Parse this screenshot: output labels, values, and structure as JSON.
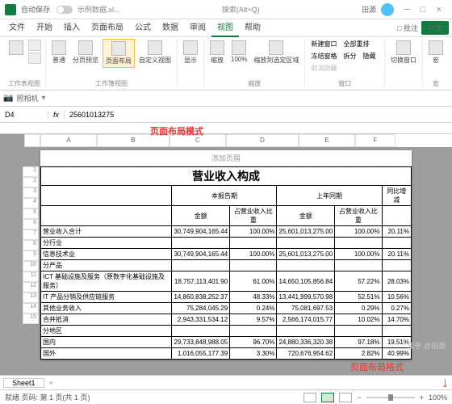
{
  "titlebar": {
    "autosave": "自动保存",
    "filename": "示例数据.xl...",
    "search": "搜索(Alt+Q)",
    "user": "田源"
  },
  "tabs": [
    "文件",
    "开始",
    "插入",
    "页面布局",
    "公式",
    "数据",
    "审阅",
    "视图",
    "帮助"
  ],
  "tabs_right": {
    "comment": "批注",
    "share": "共享"
  },
  "ribbon": {
    "group1": {
      "label": "工作表视图"
    },
    "group2": {
      "btns": [
        "普通",
        "分页预览",
        "页面布局",
        "自定义视图"
      ],
      "label": "工作簿视图"
    },
    "group3": {
      "btn": "显示",
      "label": ""
    },
    "group4": {
      "btns": [
        "缩放",
        "100%",
        "缩放到选定区域"
      ],
      "label": "缩放"
    },
    "group5": {
      "items": [
        "新建窗口",
        "全部重排",
        "冻结窗格",
        "拆分",
        "隐藏",
        "取消隐藏"
      ],
      "label": "窗口"
    },
    "group6": {
      "btns": [
        "切换窗口"
      ],
      "label": ""
    },
    "group7": {
      "btn": "宏",
      "label": "宏"
    }
  },
  "namebox_row": {
    "camera": "照相机"
  },
  "formula": {
    "cell": "D4",
    "value": "25601013275"
  },
  "annotations": {
    "mode": "页面布局模式",
    "format": "页面布局格式"
  },
  "page_header": "添加页眉",
  "columns": [
    "",
    "A",
    "B",
    "C",
    "D",
    "E",
    "F"
  ],
  "chart_data": {
    "type": "table",
    "title": "营业收入构成",
    "header1": [
      "",
      "本报告期",
      "",
      "上年同期",
      "",
      "同比增减"
    ],
    "header2": [
      "",
      "金额",
      "占营业收入比重",
      "金额",
      "占营业收入比重",
      ""
    ],
    "rows": [
      [
        "营业收入合计",
        "30,749,904,165.44",
        "100.00%",
        "25,601,013,275.00",
        "100.00%",
        "20.11%"
      ],
      [
        "分行业",
        "",
        "",
        "",
        "",
        ""
      ],
      [
        "信息技术业",
        "30,749,904,165.44",
        "100.00%",
        "25,601,013,275.00",
        "100.00%",
        "20.11%"
      ],
      [
        "分产品",
        "",
        "",
        "",
        "",
        ""
      ],
      [
        "ICT 基础设施及服务（原数字化基础设施及服务）",
        "18,757,113,401.90",
        "61.00%",
        "14,650,105,856.84",
        "57.22%",
        "28.03%"
      ],
      [
        "IT 产品分销及供应链服务",
        "14,860,838,252.37",
        "48.33%",
        "13,441,999,570.98",
        "52.51%",
        "10.56%"
      ],
      [
        "其他业务收入",
        "75,284,045.29",
        "0.24%",
        "75,081,697.53",
        "0.29%",
        "0.27%"
      ],
      [
        "合并抵消",
        "2,943,331,534.12",
        "9.57%",
        "2,566,174,015.77",
        "10.02%",
        "14.70%"
      ],
      [
        "分地区",
        "",
        "",
        "",
        "",
        ""
      ],
      [
        "国内",
        "29,733,848,988.05",
        "96.70%",
        "24,880,336,320.38",
        "97.18%",
        "19.51%"
      ],
      [
        "国外",
        "1,016,055,177.39",
        "3.30%",
        "720,676,954.62",
        "2.82%",
        "40.99%"
      ]
    ]
  },
  "sheet_tab": "Sheet1",
  "statusbar": {
    "left": "就绪  页码: 第 1 页(共 1 页)",
    "zoom": "100%"
  },
  "watermark": "知乎 @田源"
}
